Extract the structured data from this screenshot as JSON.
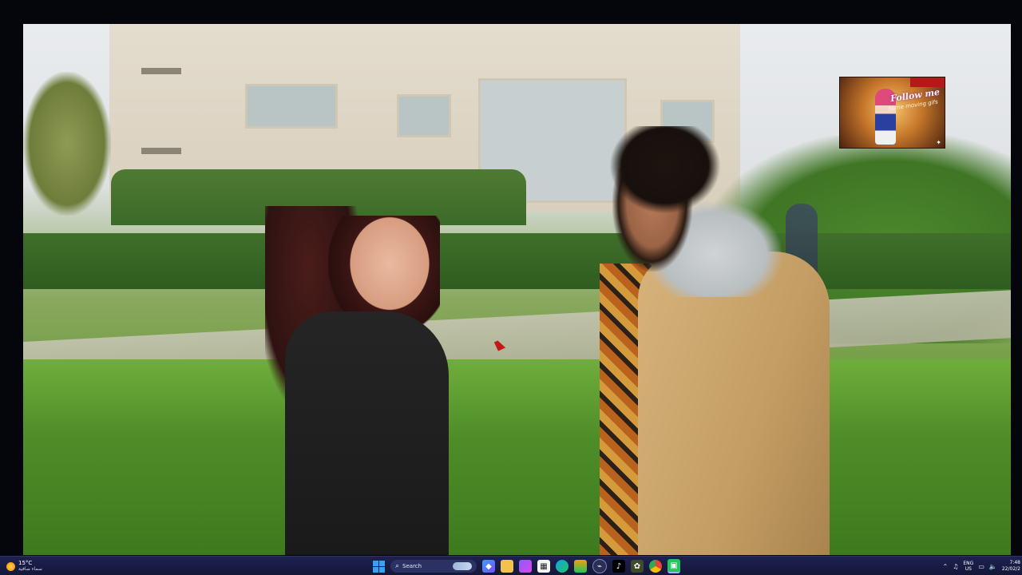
{
  "overlay": {
    "title": "Follow me",
    "subtitle": "Some moving gifs"
  },
  "taskbar": {
    "weather": {
      "temperature": "15°C",
      "condition": "سماء صافية",
      "icon": "sun-icon"
    },
    "search_label": "Search",
    "apps": [
      {
        "name": "start-button",
        "icon": "windows-logo-icon"
      },
      {
        "name": "search-box",
        "icon": "search-icon"
      },
      {
        "name": "copilot",
        "icon": "copilot-icon"
      },
      {
        "name": "file-explorer",
        "icon": "folder-icon"
      },
      {
        "name": "app-purple",
        "icon": "purple-app-icon"
      },
      {
        "name": "calendar",
        "icon": "calendar-icon"
      },
      {
        "name": "edge",
        "icon": "edge-icon"
      },
      {
        "name": "app-layers",
        "icon": "layers-icon"
      },
      {
        "name": "app-shield",
        "icon": "shield-icon"
      },
      {
        "name": "tiktok",
        "icon": "tiktok-icon"
      },
      {
        "name": "app-green",
        "icon": "green-app-icon"
      },
      {
        "name": "chrome",
        "icon": "chrome-icon"
      },
      {
        "name": "app-active",
        "icon": "active-app-icon"
      }
    ],
    "tray": {
      "language_line1": "ENG",
      "language_line2": "US",
      "time": "7:48",
      "date": "22/02/2"
    }
  },
  "colors": {
    "taskbar_bg": "#1d2150",
    "start_blue": "#3aa0f3",
    "cursor_red": "#c21818"
  }
}
